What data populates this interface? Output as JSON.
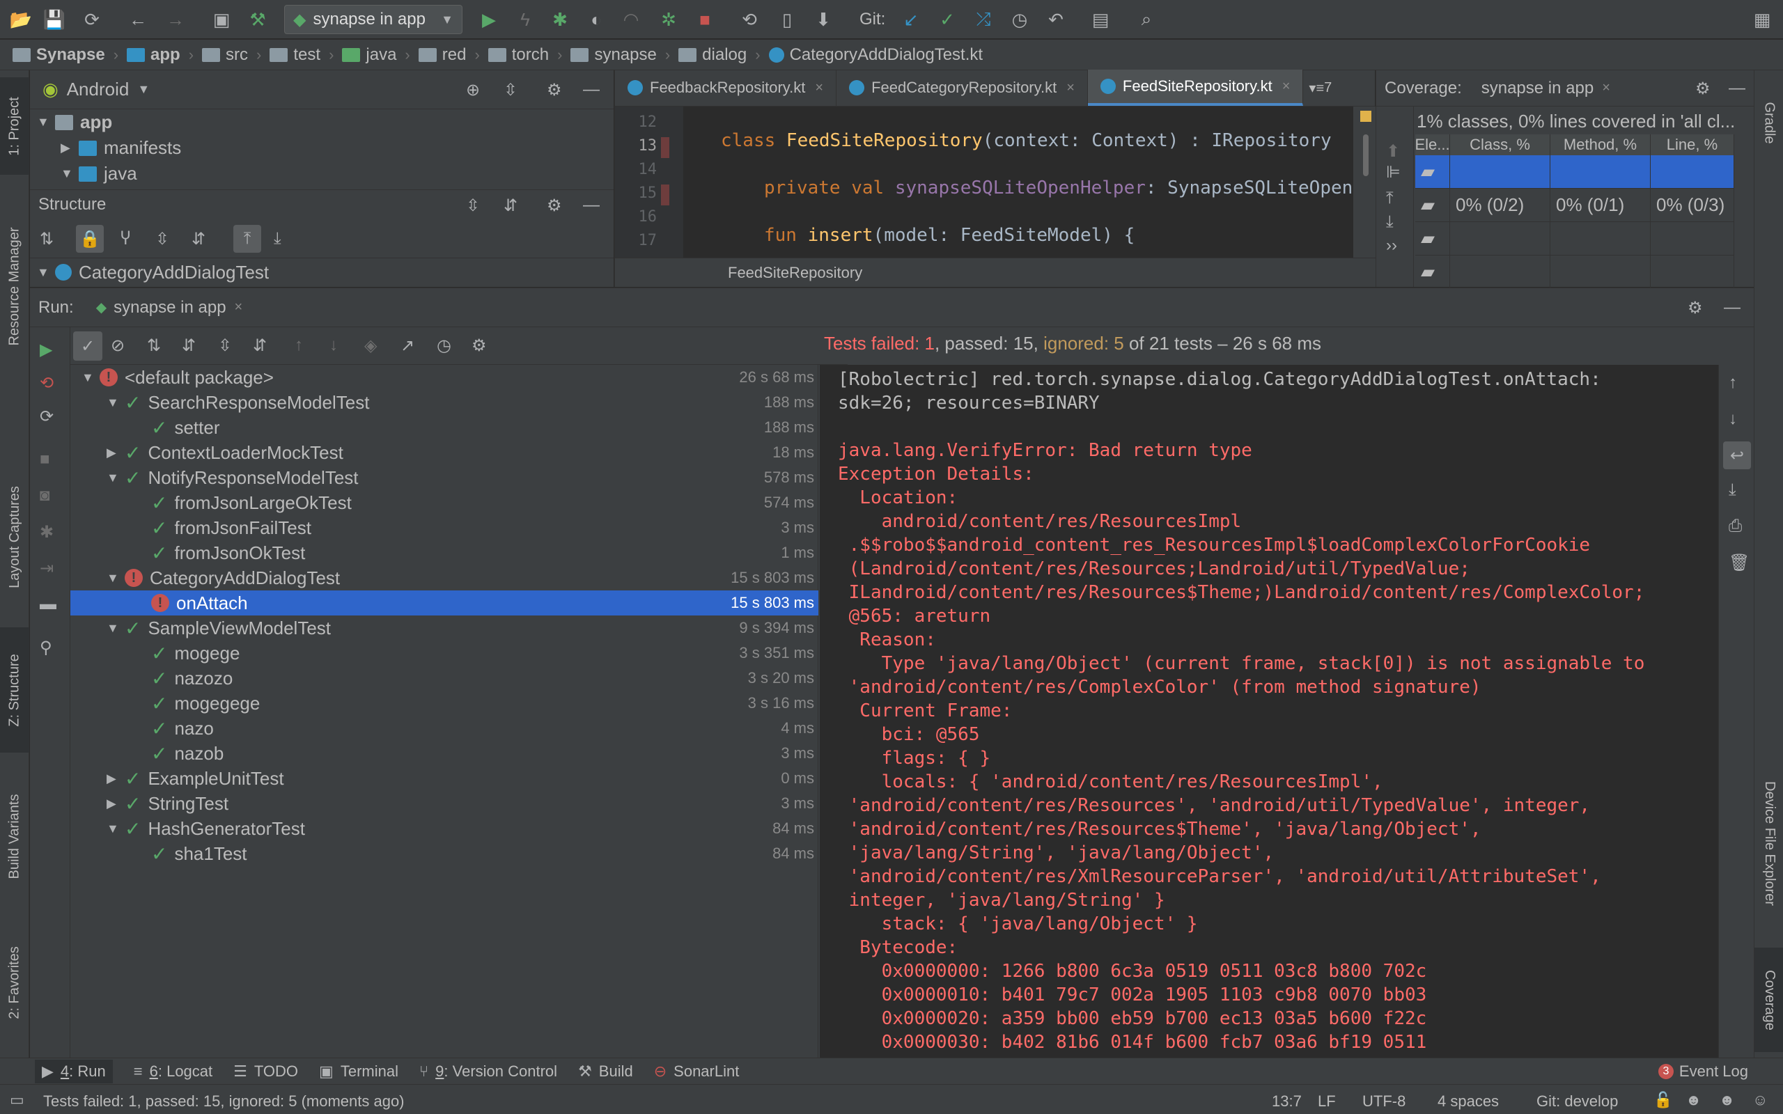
{
  "toolbar": {
    "run_config": "synapse in app",
    "git_label": "Git:"
  },
  "breadcrumb": [
    "Synapse",
    "app",
    "src",
    "test",
    "java",
    "red",
    "torch",
    "synapse",
    "dialog",
    "CategoryAddDialogTest.kt"
  ],
  "left_strip": {
    "project": "1: Project",
    "resource_manager": "Resource Manager",
    "layout_captures": "Layout Captures",
    "structure": "Z: Structure",
    "build_variants": "Build Variants",
    "favorites": "2: Favorites"
  },
  "right_strip": {
    "gradle": "Gradle",
    "device_file_explorer": "Device File Explorer",
    "coverage": "Coverage"
  },
  "project_panel": {
    "view": "Android",
    "tree": [
      {
        "label": "app"
      },
      {
        "label": "manifests"
      },
      {
        "label": "java"
      }
    ]
  },
  "structure_panel": {
    "title": "Structure",
    "root": "CategoryAddDialogTest"
  },
  "editor": {
    "tabs": [
      {
        "label": "FeedbackRepository.kt"
      },
      {
        "label": "FeedCategoryRepository.kt"
      },
      {
        "label": "FeedSiteRepository.kt"
      }
    ],
    "tab_overflow": "7",
    "line_numbers": [
      "12",
      "13",
      "14",
      "15",
      "16",
      "17"
    ],
    "lines": {
      "l13_kw": "class ",
      "l13_name": "FeedSiteRepository",
      "l13_rest": "(context: Context) : IRepository",
      "l15_kw": "private val ",
      "l15_field": "synapseSQLiteOpenHelper",
      "l15_rest": ": SynapseSQLiteOpenH",
      "l17_kw": "fun ",
      "l17_fn": "insert",
      "l17_rest": "(model: FeedSiteModel) {"
    },
    "crumb": "FeedSiteRepository"
  },
  "coverage": {
    "label": "Coverage:",
    "tab": "synapse in app",
    "summary": "1% classes, 0% lines covered in 'all cl...",
    "headers": [
      "Ele...",
      "Class, %",
      "Method, %",
      "Line, %"
    ],
    "rows": [
      {
        "class": "",
        "method": "",
        "line": ""
      },
      {
        "class": "0% (0/2)",
        "method": "0% (0/1)",
        "line": "0% (0/3)"
      },
      {
        "class": "",
        "method": "",
        "line": ""
      },
      {
        "class": "",
        "method": "",
        "line": ""
      }
    ]
  },
  "run": {
    "label": "Run:",
    "tab": "synapse in app",
    "status": {
      "failed": "Tests failed: 1",
      "passed": ", passed: 15, ",
      "ignored": "ignored: 5",
      "rest": " of 21 tests – 26 s 68 ms"
    },
    "tests": [
      {
        "label": "<default package>",
        "dur": "26 s 68 ms"
      },
      {
        "label": "SearchResponseModelTest",
        "dur": "188 ms"
      },
      {
        "label": "setter",
        "dur": "188 ms"
      },
      {
        "label": "ContextLoaderMockTest",
        "dur": "18 ms"
      },
      {
        "label": "NotifyResponseModelTest",
        "dur": "578 ms"
      },
      {
        "label": "fromJsonLargeOkTest",
        "dur": "574 ms"
      },
      {
        "label": "fromJsonFailTest",
        "dur": "3 ms"
      },
      {
        "label": "fromJsonOkTest",
        "dur": "1 ms"
      },
      {
        "label": "CategoryAddDialogTest",
        "dur": "15 s 803 ms"
      },
      {
        "label": "onAttach",
        "dur": "15 s 803 ms"
      },
      {
        "label": "SampleViewModelTest",
        "dur": "9 s 394 ms"
      },
      {
        "label": "mogege",
        "dur": "3 s 351 ms"
      },
      {
        "label": "nazozo",
        "dur": "3 s 20 ms"
      },
      {
        "label": "mogegege",
        "dur": "3 s 16 ms"
      },
      {
        "label": "nazo",
        "dur": "4 ms"
      },
      {
        "label": "nazob",
        "dur": "3 ms"
      },
      {
        "label": "ExampleUnitTest",
        "dur": "0 ms"
      },
      {
        "label": "StringTest",
        "dur": "3 ms"
      },
      {
        "label": "HashGeneratorTest",
        "dur": "84 ms"
      },
      {
        "label": "sha1Test",
        "dur": "84 ms"
      }
    ],
    "console": [
      "[Robolectric] red.torch.synapse.dialog.CategoryAddDialogTest.onAttach:",
      "sdk=26; resources=BINARY",
      "",
      "java.lang.VerifyError: Bad return type",
      "Exception Details:",
      "  Location:",
      "    android/content/res/ResourcesImpl",
      " .$$robo$$android_content_res_ResourcesImpl$loadComplexColorForCookie",
      " (Landroid/content/res/Resources;Landroid/util/TypedValue;",
      " ILandroid/content/res/Resources$Theme;)Landroid/content/res/ComplexColor;",
      " @565: areturn",
      "  Reason:",
      "    Type 'java/lang/Object' (current frame, stack[0]) is not assignable to",
      " 'android/content/res/ComplexColor' (from method signature)",
      "  Current Frame:",
      "    bci: @565",
      "    flags: { }",
      "    locals: { 'android/content/res/ResourcesImpl',",
      " 'android/content/res/Resources', 'android/util/TypedValue', integer,",
      " 'android/content/res/Resources$Theme', 'java/lang/Object',",
      " 'java/lang/String', 'java/lang/Object',",
      " 'android/content/res/XmlResourceParser', 'android/util/AttributeSet',",
      " integer, 'java/lang/String' }",
      "    stack: { 'java/lang/Object' }",
      "  Bytecode:",
      "    0x0000000: 1266 b800 6c3a 0519 0511 03c8 b800 702c",
      "    0x0000010: b401 79c7 002a 1905 1103 c9b8 0070 bb03",
      "    0x0000020: a359 bb00 eb59 b700 ec13 03a5 b600 f22c",
      "    0x0000030: b402 81b6 014f b600 fcb7 03a6 bf19 0511"
    ]
  },
  "bottom_tabs": [
    {
      "num": "4",
      "label": ": Run"
    },
    {
      "num": "6",
      "label": ": Logcat"
    },
    {
      "num": "",
      "label": "TODO"
    },
    {
      "num": "",
      "label": "Terminal"
    },
    {
      "num": "9",
      "label": ": Version Control"
    },
    {
      "num": "",
      "label": "Build"
    },
    {
      "num": "",
      "label": "SonarLint"
    }
  ],
  "event_log": {
    "count": "3",
    "label": "Event Log"
  },
  "status_bar": {
    "message": "Tests failed: 1, passed: 15, ignored: 5 (moments ago)",
    "position": "13:7",
    "line_sep": "LF",
    "encoding": "UTF-8",
    "indent": "4 spaces",
    "branch": "Git: develop"
  },
  "colors": {
    "accent": "#2f65ca",
    "error": "#ff6b68",
    "ok": "#59a869",
    "ignored": "#c19a5c"
  }
}
